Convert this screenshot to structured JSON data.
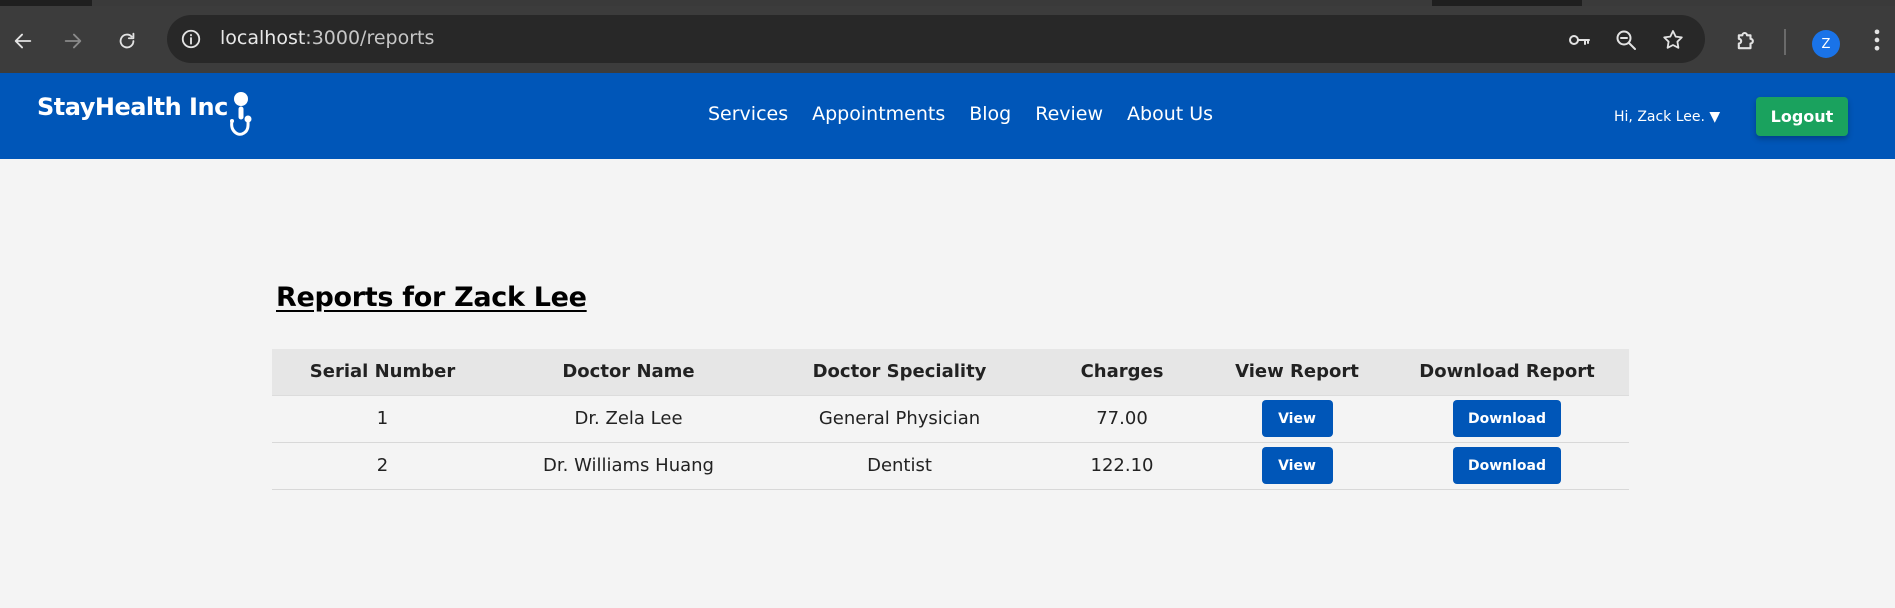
{
  "browser": {
    "url_host": "localhost",
    "url_path": ":3000/reports",
    "profile_initial": "Z"
  },
  "header": {
    "brand": "StayHealth Inc",
    "nav": [
      "Services",
      "Appointments",
      "Blog",
      "Review",
      "About Us"
    ],
    "user_greeting": "Hi, Zack Lee. ▼",
    "logout_label": "Logout",
    "colors": {
      "header_bg": "#0056b8",
      "logout_bg": "#1aa25e"
    }
  },
  "main": {
    "title": "Reports for Zack Lee",
    "table": {
      "columns": [
        "Serial Number",
        "Doctor Name",
        "Doctor Speciality",
        "Charges",
        "View Report",
        "Download Report"
      ],
      "rows": [
        {
          "serial": "1",
          "doctor": "Dr. Zela Lee",
          "speciality": "General Physician",
          "charges": "77.00",
          "view_label": "View",
          "download_label": "Download"
        },
        {
          "serial": "2",
          "doctor": "Dr. Williams Huang",
          "speciality": "Dentist",
          "charges": "122.10",
          "view_label": "View",
          "download_label": "Download"
        }
      ]
    }
  }
}
